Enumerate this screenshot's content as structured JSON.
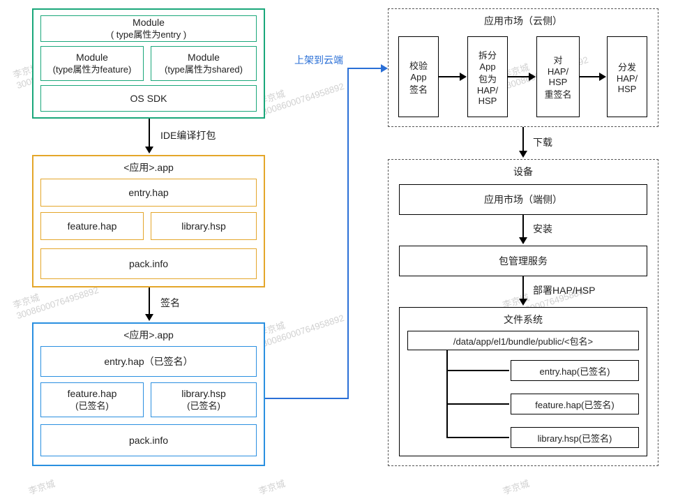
{
  "watermark": {
    "name": "李京城",
    "id": "30086000764958892"
  },
  "left": {
    "green": {
      "entry": {
        "top": "Module",
        "sub": "( type属性为entry )"
      },
      "feature": {
        "top": "Module",
        "sub": "(type属性为feature)"
      },
      "shared": {
        "top": "Module",
        "sub": "(type属性为shared)"
      },
      "sdk": "OS SDK"
    },
    "to_orange_label": "IDE编译打包",
    "orange": {
      "title": "<应用>.app",
      "entry": "entry.hap",
      "feature": "feature.hap",
      "library": "library.hsp",
      "pack": "pack.info"
    },
    "to_blue_label": "签名",
    "blue": {
      "title": "<应用>.app",
      "entry": "entry.hap（已签名）",
      "feature_top": "feature.hap",
      "feature_sub": "(已签名)",
      "library_top": "library.hsp",
      "library_sub": "(已签名)",
      "pack": "pack.info"
    },
    "upload_label": "上架到云端"
  },
  "cloud": {
    "title": "应用市场（云侧）",
    "s1": {
      "a": "校验",
      "b": "App",
      "c": "签名"
    },
    "s2": {
      "a": "拆分",
      "b": "App",
      "c": "包为",
      "d": "HAP/",
      "e": "HSP"
    },
    "s3": {
      "a": "对",
      "b": "HAP/",
      "c": "HSP",
      "d": "重签名"
    },
    "s4": {
      "a": "分发",
      "b": "HAP/",
      "c": "HSP"
    },
    "download_label": "下载"
  },
  "device": {
    "title": "设备",
    "market": "应用市场（端侧）",
    "install_label": "安装",
    "pms": "包管理服务",
    "deploy_label": "部署HAP/HSP",
    "fs": {
      "title": "文件系统",
      "path": "/data/app/el1/bundle/public/<包名>",
      "f1": "entry.hap(已签名)",
      "f2": "feature.hap(已签名)",
      "f3": "library.hsp(已签名)"
    }
  }
}
